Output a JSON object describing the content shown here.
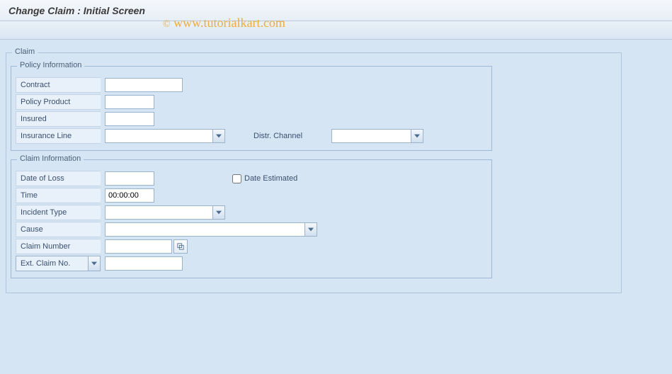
{
  "header": {
    "title": "Change Claim : Initial Screen"
  },
  "watermark": "www.tutorialkart.com",
  "outer_group": {
    "title": "Claim",
    "policy": {
      "title": "Policy Information",
      "contract_label": "Contract",
      "contract_value": "",
      "policy_product_label": "Policy Product",
      "policy_product_value": "",
      "insured_label": "Insured",
      "insured_value": "",
      "insurance_line_label": "Insurance Line",
      "insurance_line_value": "",
      "distr_channel_label": "Distr. Channel",
      "distr_channel_value": ""
    },
    "claim": {
      "title": "Claim Information",
      "date_of_loss_label": "Date of Loss",
      "date_of_loss_value": "",
      "date_estimated_label": "Date Estimated",
      "date_estimated_checked": false,
      "time_label": "Time",
      "time_value": "00:00:00",
      "incident_type_label": "Incident Type",
      "incident_type_value": "",
      "cause_label": "Cause",
      "cause_value": "",
      "claim_number_label": "Claim Number",
      "claim_number_value": "",
      "ext_claim_select_label": "Ext. Claim No.",
      "ext_claim_value": ""
    }
  }
}
